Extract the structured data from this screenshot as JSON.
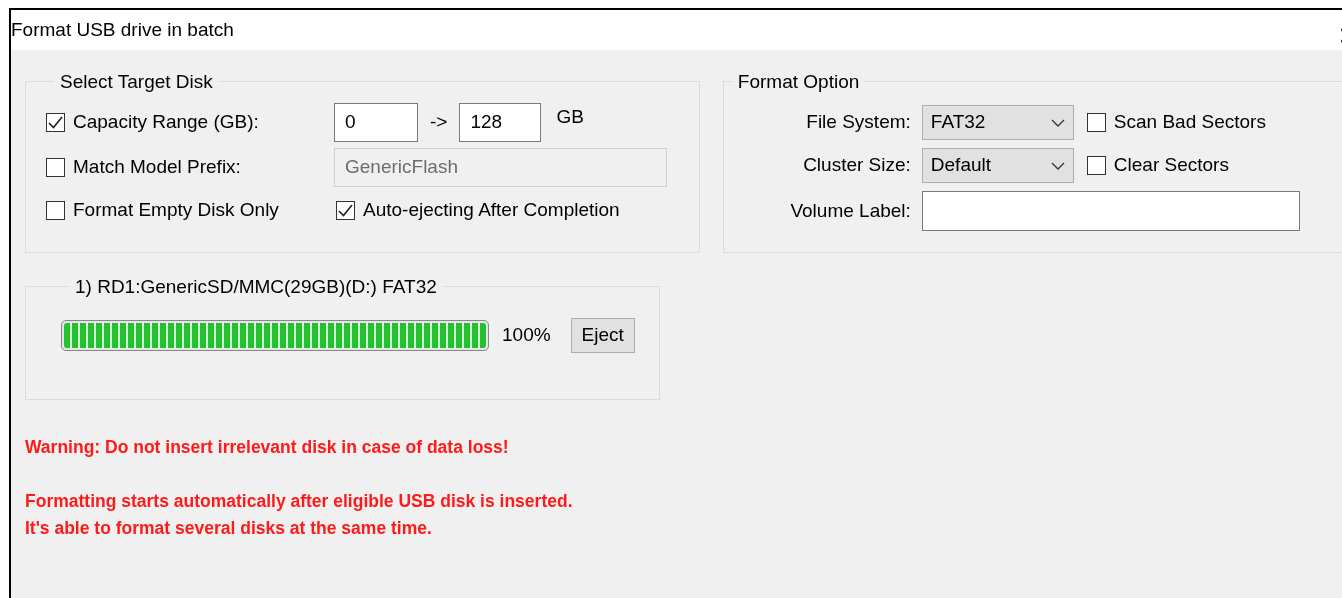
{
  "window": {
    "title": "Format USB drive in batch"
  },
  "target_disk": {
    "title": "Select Target Disk",
    "capacity_range": {
      "label": "Capacity Range (GB):",
      "checked": true,
      "from": "0",
      "arrow": "->",
      "to": "128",
      "unit": "GB"
    },
    "model_prefix": {
      "label": "Match Model Prefix:",
      "checked": false,
      "value": "GenericFlash",
      "disabled": true
    },
    "options": [
      {
        "label": "Format Empty Disk Only",
        "checked": false
      },
      {
        "label": "Auto-ejecting After Completion",
        "checked": true
      }
    ]
  },
  "format_option": {
    "title": "Format Option",
    "file_system": {
      "label": "File System:",
      "value": "FAT32"
    },
    "cluster_size": {
      "label": "Cluster Size:",
      "value": "Default"
    },
    "checks": [
      {
        "label": "Scan Bad Sectors",
        "checked": false
      },
      {
        "label": "Clear Sectors",
        "checked": false
      }
    ],
    "volume_label": {
      "label": "Volume Label:"
    }
  },
  "disks": [
    {
      "title": "1) RD1:GenericSD/MMC(29GB)(D:) FAT32",
      "level": 1,
      "percent": "100%",
      "button": "Eject"
    }
  ],
  "messages": [
    {
      "lines": [
        "Warning: Do not insert irrelevant disk in case of data loss!"
      ]
    },
    {
      "lines": [
        "Formatting starts automatically after eligible USB disk is inserted.",
        "It's able to format several disks at the same time."
      ]
    }
  ]
}
